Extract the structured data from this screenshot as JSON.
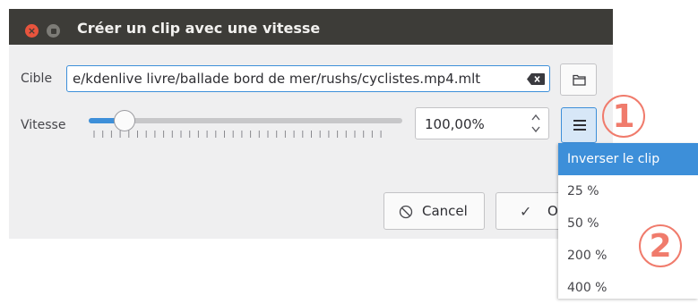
{
  "window": {
    "title": "Créer un clip avec une vitesse"
  },
  "target": {
    "label": "Cible",
    "path": "e/kdenlive livre/ballade bord de mer/rushs/cyclistes.mp4.mlt"
  },
  "speed": {
    "label": "Vitesse",
    "value": "100,00%",
    "slider_level_fraction": 0.1
  },
  "buttons": {
    "cancel_label": "Cancel",
    "ok_label": "O"
  },
  "menu": {
    "items": [
      {
        "label": "Inverser le clip",
        "active": true
      },
      {
        "label": "25 %"
      },
      {
        "label": "50 %"
      },
      {
        "label": "200 %"
      },
      {
        "label": "400 %"
      }
    ]
  },
  "callouts": [
    "1",
    "2"
  ],
  "colors": {
    "accent": "#3d8fd9",
    "titlebar": "#3d3c38",
    "callout": "#f07b6c"
  }
}
